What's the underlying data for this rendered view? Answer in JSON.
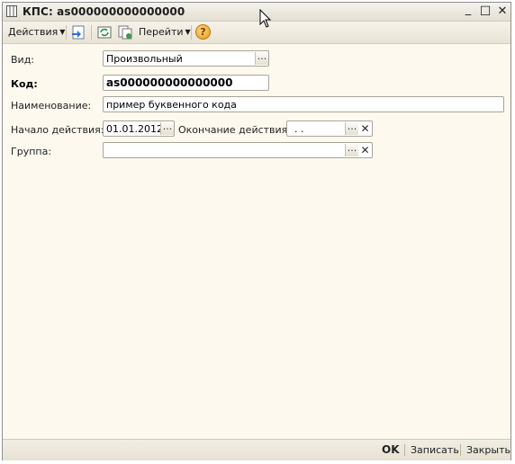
{
  "window": {
    "title": "КПС: as000000000000000",
    "controls": {
      "minimize": "_",
      "maximize": "☐",
      "close": "✕"
    }
  },
  "toolbar": {
    "actions_label": "Действия",
    "goto_label": "Перейти",
    "help_symbol": "?",
    "icons": [
      "save-and-close-icon",
      "refresh-icon",
      "copy-icon",
      "help-icon"
    ]
  },
  "form": {
    "vid": {
      "label": "Вид:",
      "value": "Произвольный",
      "button": "..."
    },
    "kod": {
      "label": "Код:",
      "value": "as000000000000000"
    },
    "name": {
      "label": "Наименование:",
      "value": "пример буквенного кода"
    },
    "start": {
      "label": "Начало действия:",
      "value": "01.01.2012",
      "button": "..."
    },
    "end": {
      "label": "Окончание действия:",
      "value": ". .",
      "button": "...",
      "clear": "✕"
    },
    "group": {
      "label": "Группа:",
      "value": "",
      "button": "...",
      "clear": "✕"
    }
  },
  "footer": {
    "ok_label": "OK",
    "save_label": "Записать",
    "close_label": "Закрыть"
  },
  "colors": {
    "window_bg": "#fdf9ef",
    "help_icon": "#f0a830"
  }
}
